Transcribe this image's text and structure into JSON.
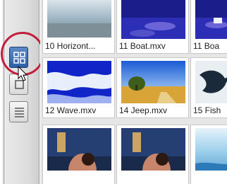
{
  "toolbar": {
    "buttons": [
      {
        "name": "thumbnail-view",
        "icon": "grid-view-icon",
        "active": true
      },
      {
        "name": "single-view",
        "icon": "square-view-icon",
        "active": false
      },
      {
        "name": "list-view",
        "icon": "list-view-icon",
        "active": false
      }
    ],
    "highlight_color": "#c21d3c"
  },
  "thumbnails": [
    {
      "label": "10 Horizont...",
      "scene": "horizon"
    },
    {
      "label": "11 Boat.mxv",
      "scene": "boat"
    },
    {
      "label": "11 Boa",
      "scene": "boat"
    },
    {
      "label": "12 Wave.mxv",
      "scene": "wave"
    },
    {
      "label": "14 Jeep.mxv",
      "scene": "jeep"
    },
    {
      "label": "15 Fish",
      "scene": "fish"
    },
    {
      "label": "",
      "scene": "couple"
    },
    {
      "label": "",
      "scene": "couple"
    },
    {
      "label": "",
      "scene": "sea"
    }
  ]
}
